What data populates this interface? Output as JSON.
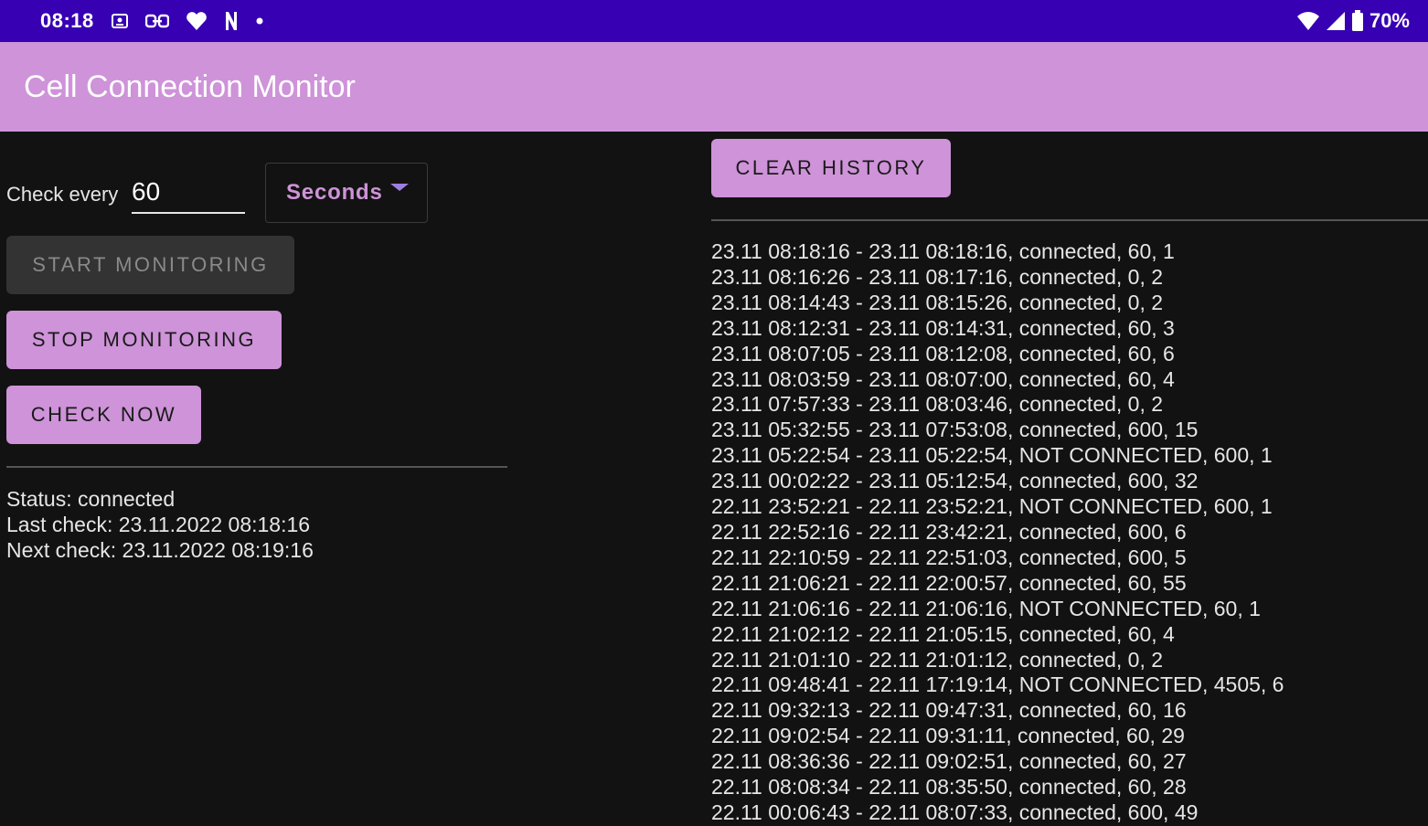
{
  "status_bar": {
    "time": "08:18",
    "notification_icons": [
      "image-icon",
      "link-icon",
      "heart-icon",
      "n-icon",
      "dot-icon"
    ],
    "battery": "70%",
    "status_icons": [
      "wifi-icon",
      "signal-icon",
      "battery-icon"
    ]
  },
  "app_bar": {
    "title": "Cell Connection Monitor"
  },
  "controls": {
    "check_every_label": "Check every",
    "interval_value": "60",
    "unit_value": "Seconds",
    "start_label": "START MONITORING",
    "stop_label": "STOP MONITORING",
    "check_now_label": "CHECK NOW"
  },
  "status": {
    "status_line": "Status: connected",
    "last_check_line": "Last check: 23.11.2022 08:18:16",
    "next_check_line": "Next check: 23.11.2022 08:19:16"
  },
  "history": {
    "clear_label": "CLEAR HISTORY",
    "entries": [
      "23.11 08:18:16 - 23.11 08:18:16, connected, 60, 1",
      "23.11 08:16:26 - 23.11 08:17:16, connected, 0, 2",
      "23.11 08:14:43 - 23.11 08:15:26, connected, 0, 2",
      "23.11 08:12:31 - 23.11 08:14:31, connected, 60, 3",
      "23.11 08:07:05 - 23.11 08:12:08, connected, 60, 6",
      "23.11 08:03:59 - 23.11 08:07:00, connected, 60, 4",
      "23.11 07:57:33 - 23.11 08:03:46, connected, 0, 2",
      "23.11 05:32:55 - 23.11 07:53:08, connected, 600, 15",
      "23.11 05:22:54 - 23.11 05:22:54, NOT CONNECTED, 600, 1",
      "23.11 00:02:22 - 23.11 05:12:54, connected, 600, 32",
      "22.11 23:52:21 - 22.11 23:52:21, NOT CONNECTED, 600, 1",
      "22.11 22:52:16 - 22.11 23:42:21, connected, 600, 6",
      "22.11 22:10:59 - 22.11 22:51:03, connected, 600, 5",
      "22.11 21:06:21 - 22.11 22:00:57, connected, 60, 55",
      "22.11 21:06:16 - 22.11 21:06:16, NOT CONNECTED, 60, 1",
      "22.11 21:02:12 - 22.11 21:05:15, connected, 60, 4",
      "22.11 21:01:10 - 22.11 21:01:12, connected, 0, 2",
      "22.11 09:48:41 - 22.11 17:19:14, NOT CONNECTED, 4505, 6",
      "22.11 09:32:13 - 22.11 09:47:31, connected, 60, 16",
      "22.11 09:02:54 - 22.11 09:31:11, connected, 60, 29",
      "22.11 08:36:36 - 22.11 09:02:51, connected, 60, 27",
      "22.11 08:08:34 - 22.11 08:35:50, connected, 60, 28",
      "22.11 00:06:43 - 22.11 08:07:33, connected, 600, 49"
    ]
  },
  "colors": {
    "status_bar_bg": "#3700b3",
    "accent": "#ce93d8",
    "background": "#121212",
    "disabled_button": "#333333"
  }
}
